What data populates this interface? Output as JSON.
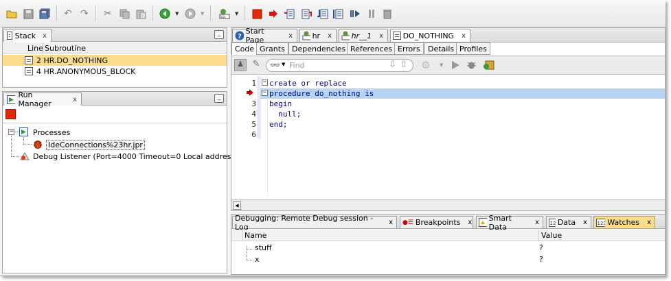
{
  "toolbar": {
    "icons": [
      "open-folder-icon",
      "save-icon",
      "save-all-icon",
      "undo-icon",
      "redo-icon",
      "cut-icon",
      "copy-icon",
      "paste-icon",
      "back-icon",
      "forward-icon",
      "sql-connection-icon",
      "stop-icon",
      "resume-icon",
      "step-over-icon",
      "step-into-icon",
      "step-out-icon",
      "step-to-end-icon",
      "resume-debug-icon",
      "pause-icon",
      "garbage-collect-icon"
    ]
  },
  "stack": {
    "title": "Stack",
    "columns": [
      "Line",
      "Subroutine"
    ],
    "rows": [
      {
        "text": "2 HR.DO_NOTHING"
      },
      {
        "text": "4 HR.ANONYMOUS_BLOCK"
      }
    ]
  },
  "run_manager": {
    "title": "Run Manager",
    "tree": {
      "processes": "Processes",
      "connection": "IdeConnections%23hr.jpr",
      "listener": "Debug Listener (Port=4000 Timeout=0 Local addres"
    }
  },
  "editor": {
    "tabs": [
      "Start Page",
      "hr",
      "hr__1",
      "DO_NOTHING"
    ],
    "subtabs": [
      "Code",
      "Grants",
      "Dependencies",
      "References",
      "Errors",
      "Details",
      "Profiles"
    ],
    "find_placeholder": "Find",
    "line_numbers": [
      "1",
      "2",
      "3",
      "4",
      "5",
      "6"
    ],
    "code": [
      "create or replace",
      "procedure do_nothing is",
      "begin",
      "  null;",
      "end;",
      ""
    ],
    "colors": {
      "highlight": "#b8d4f4",
      "keyword": "#00008b",
      "selection": "#fadc8c",
      "breakpoint": "#d00000"
    }
  },
  "bottom": {
    "tabs": [
      "Debugging: Remote Debug session - Log",
      "Breakpoints",
      "Smart Data",
      "Data",
      "Watches"
    ],
    "columns": [
      "Name",
      "Value"
    ],
    "rows": [
      {
        "name": "stuff",
        "value": "?"
      },
      {
        "name": "x",
        "value": "?"
      }
    ]
  }
}
